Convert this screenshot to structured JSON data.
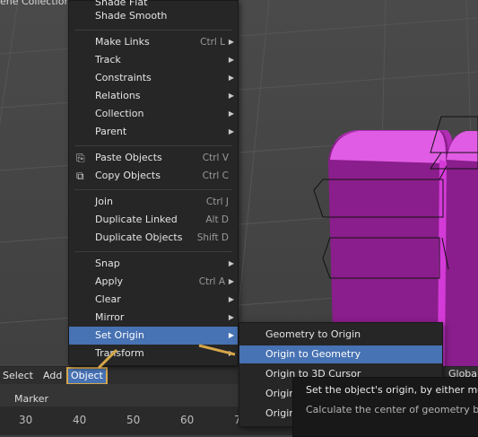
{
  "scene": {
    "collection_label": "ene Collection"
  },
  "header": {
    "items": [
      {
        "label": "Select"
      },
      {
        "label": "Add"
      },
      {
        "label": "Object"
      }
    ],
    "global_label": "Global"
  },
  "object_menu": {
    "cut_label": "Shade Flat",
    "items": [
      {
        "label": "Shade Smooth",
        "shortcut": ""
      },
      {
        "label": "Make Links",
        "shortcut": "Ctrl L"
      },
      {
        "label": "Track",
        "shortcut": ""
      },
      {
        "label": "Constraints",
        "shortcut": ""
      },
      {
        "label": "Relations",
        "shortcut": ""
      },
      {
        "label": "Collection",
        "shortcut": ""
      },
      {
        "label": "Parent",
        "shortcut": ""
      },
      {
        "label": "Paste Objects",
        "shortcut": "Ctrl V"
      },
      {
        "label": "Copy Objects",
        "shortcut": "Ctrl C"
      },
      {
        "label": "Join",
        "shortcut": "Ctrl J"
      },
      {
        "label": "Duplicate Linked",
        "shortcut": "Alt D"
      },
      {
        "label": "Duplicate Objects",
        "shortcut": "Shift D"
      },
      {
        "label": "Snap",
        "shortcut": ""
      },
      {
        "label": "Apply",
        "shortcut": "Ctrl A"
      },
      {
        "label": "Clear",
        "shortcut": ""
      },
      {
        "label": "Mirror",
        "shortcut": ""
      },
      {
        "label": "Set Origin",
        "shortcut": ""
      },
      {
        "label": "Transform",
        "shortcut": ""
      }
    ]
  },
  "origin_submenu": {
    "items": [
      {
        "label": "Geometry to Origin"
      },
      {
        "label": "Origin to Geometry"
      },
      {
        "label": "Origin to 3D Cursor"
      },
      {
        "label": "Origin"
      },
      {
        "label": "Origin"
      }
    ]
  },
  "tooltip": {
    "title": "Set the object's origin, by either moving",
    "description": "Calculate the center of geometry based"
  },
  "timeline": {
    "marker_label": "Marker",
    "frames": [
      "30",
      "40",
      "50",
      "60",
      "7"
    ]
  },
  "colors": {
    "accent": "#4772b3",
    "highlight_outline": "#d6a74b",
    "object_color": "#d43ad8"
  }
}
